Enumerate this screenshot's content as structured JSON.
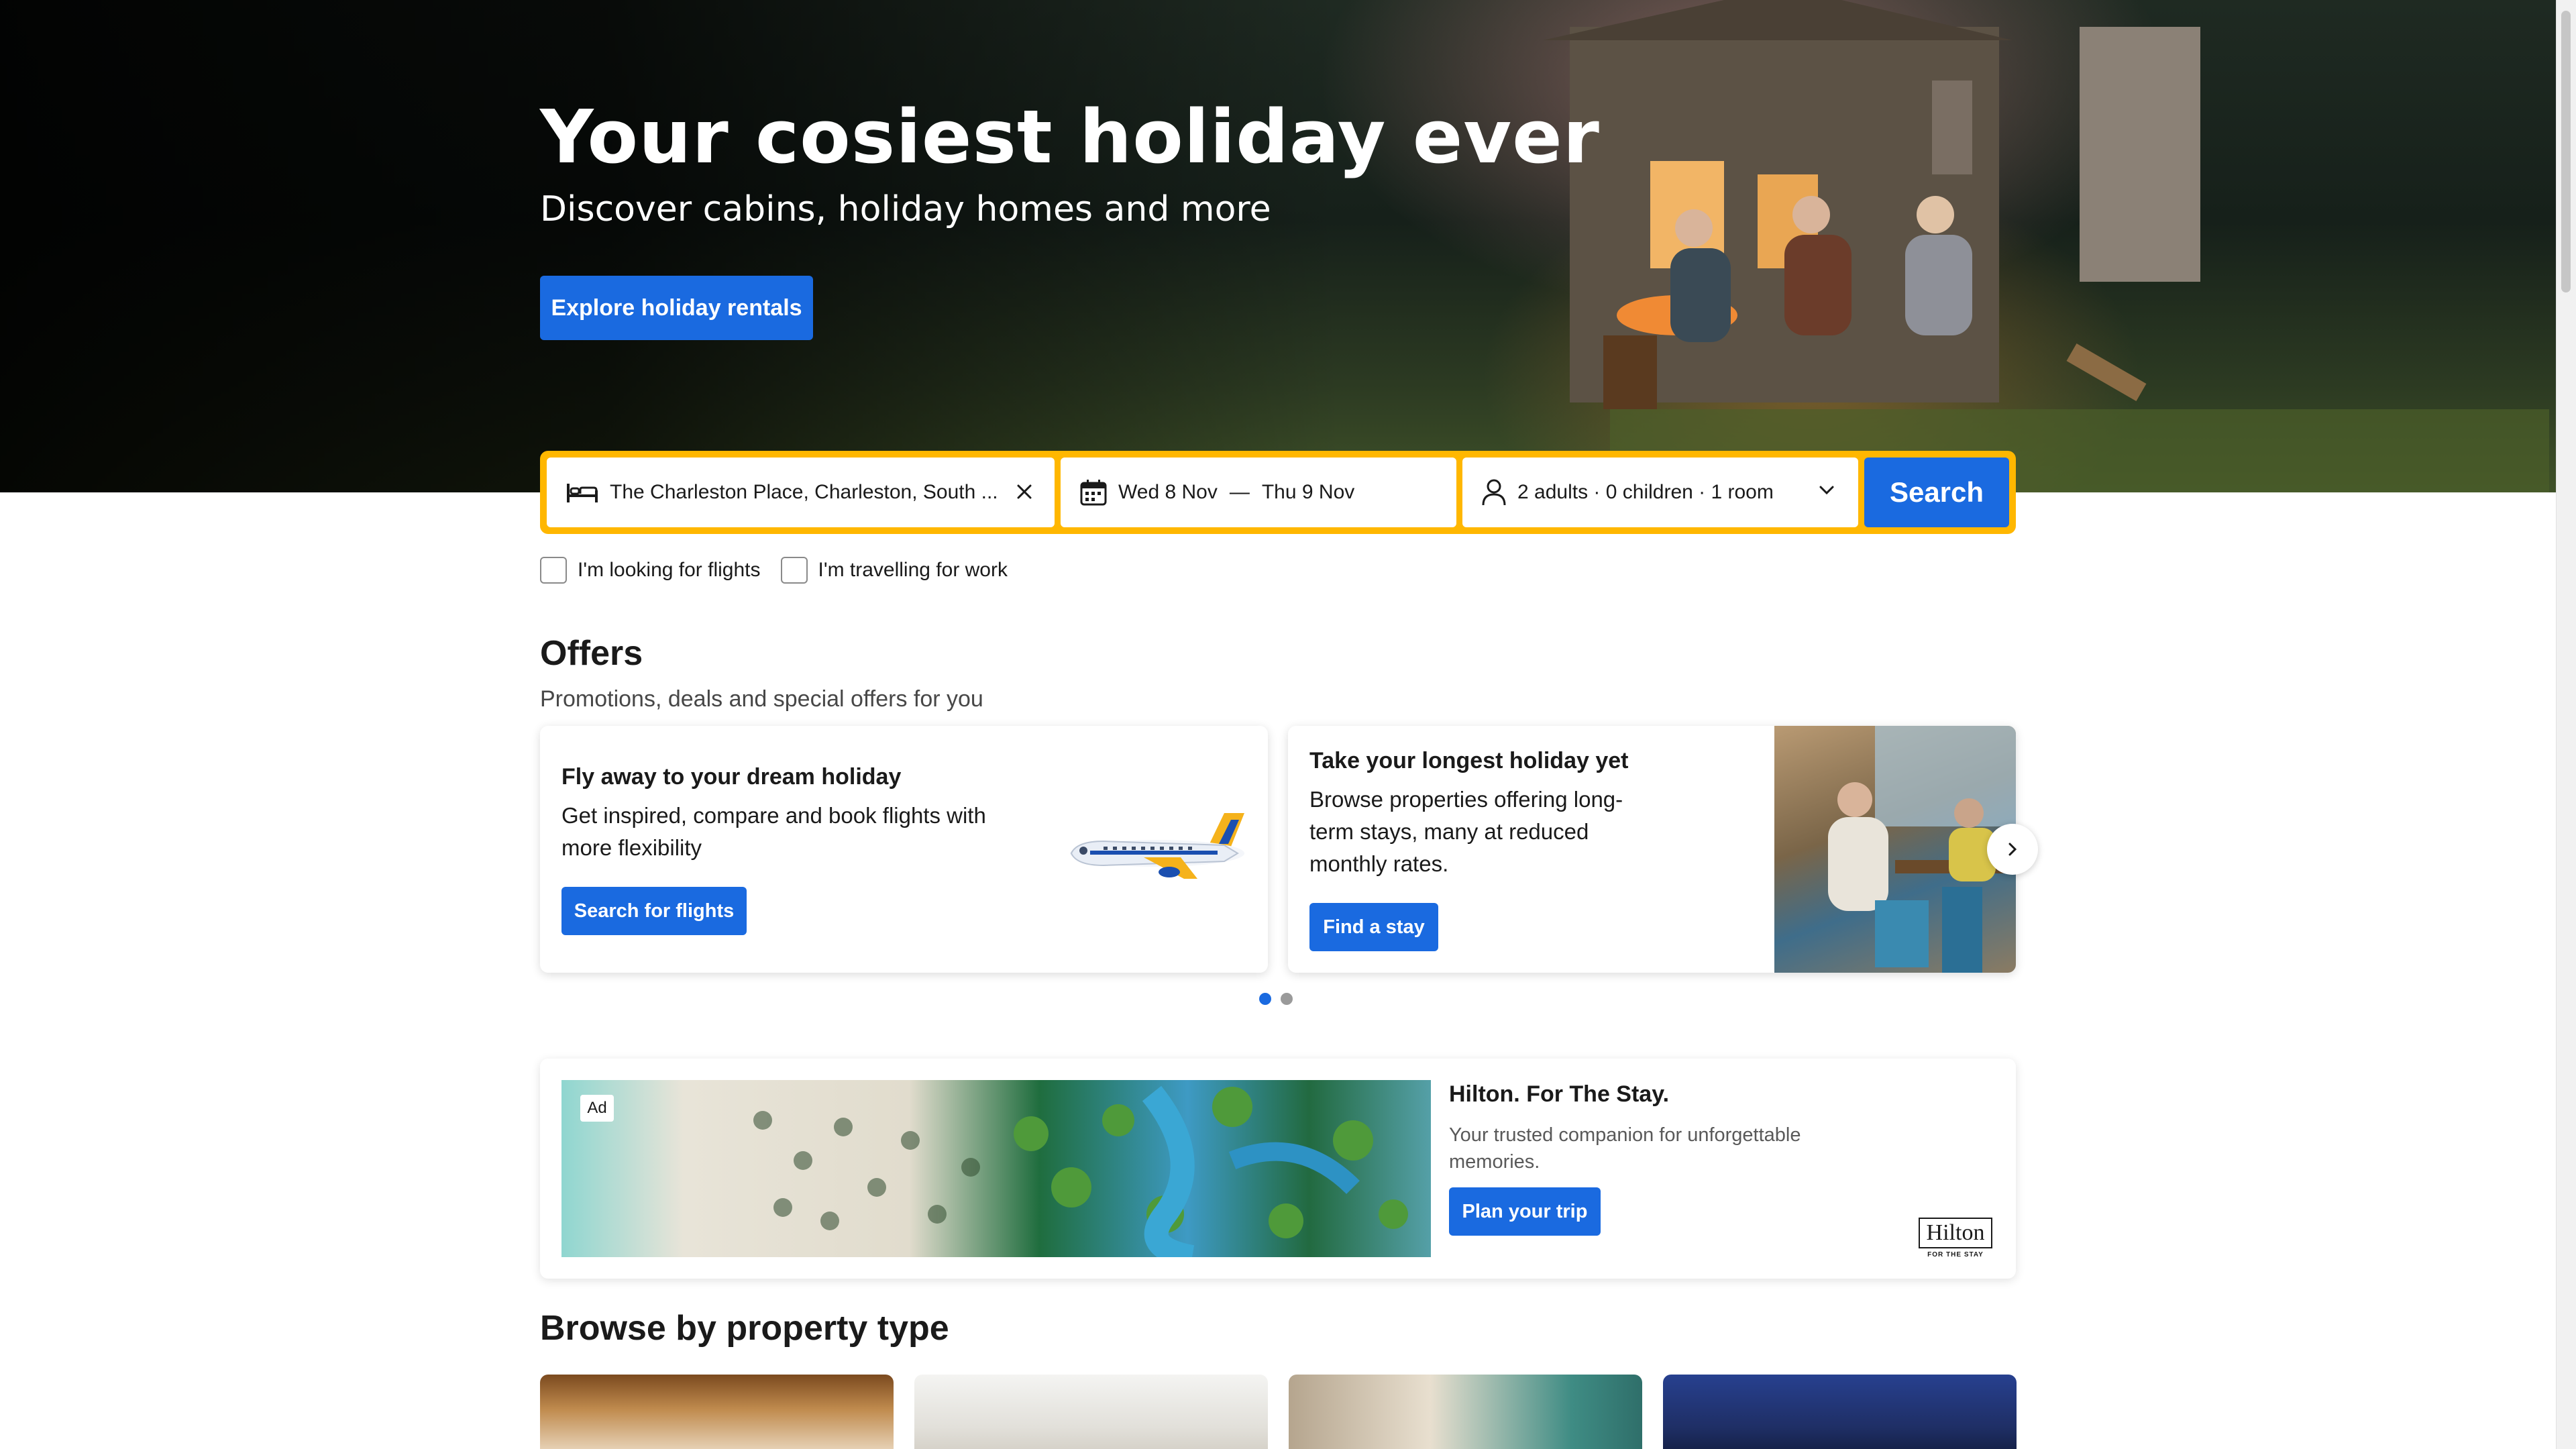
{
  "hero": {
    "title": "Your cosiest holiday ever",
    "subtitle": "Discover cabins, holiday homes and more",
    "cta_label": "Explore holiday rentals"
  },
  "search": {
    "destination": "The Charleston Place, Charleston, South ...",
    "check_in": "Wed 8 Nov",
    "date_separator": "—",
    "check_out": "Thu 9 Nov",
    "guests": "2 adults · 0 children · 1 room",
    "button_label": "Search"
  },
  "options": {
    "flights_label": "I'm looking for flights",
    "work_label": "I'm travelling for work"
  },
  "offers": {
    "title": "Offers",
    "subtitle": "Promotions, deals and special offers for you",
    "cards": [
      {
        "title": "Fly away to your dream holiday",
        "text": "Get inspired, compare and book flights with more flexibility",
        "button": "Search for flights"
      },
      {
        "title": "Take your longest holiday yet",
        "text": "Browse properties offering long-term stays, many at reduced monthly rates.",
        "button": "Find a stay"
      }
    ],
    "pagination": {
      "current": 1,
      "total": 2
    }
  },
  "ad": {
    "badge": "Ad",
    "title": "Hilton. For The Stay.",
    "text": "Your trusted companion for unforgettable memories.",
    "button": "Plan your trip",
    "logo_text": "Hilton",
    "logo_sub": "FOR THE STAY"
  },
  "browse": {
    "title": "Browse by property type"
  },
  "colors": {
    "primary_blue": "#1a6ae0",
    "search_border_yellow": "#ffb700"
  }
}
